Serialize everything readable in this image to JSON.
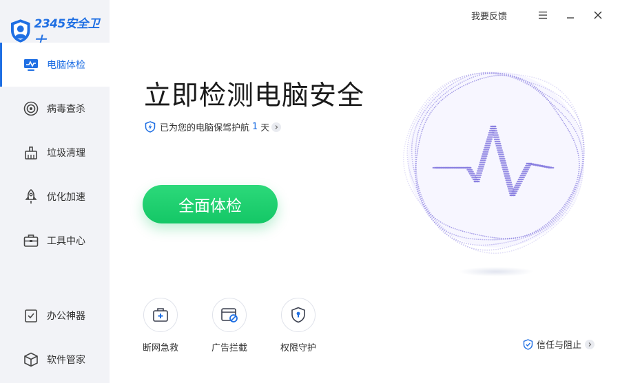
{
  "app": {
    "brand": "2345安全卫士"
  },
  "titlebar": {
    "feedback": "我要反馈",
    "menu_icon": "hamburger-menu-icon",
    "minimize_icon": "minimize-icon",
    "close_icon": "close-icon"
  },
  "sidebar": {
    "items": [
      {
        "label": "电脑体检",
        "icon": "monitor-check-icon",
        "active": true
      },
      {
        "label": "病毒查杀",
        "icon": "target-icon",
        "active": false
      },
      {
        "label": "垃圾清理",
        "icon": "broom-icon",
        "active": false
      },
      {
        "label": "优化加速",
        "icon": "rocket-icon",
        "active": false
      },
      {
        "label": "工具中心",
        "icon": "toolbox-icon",
        "active": false
      },
      {
        "label": "办公神器",
        "icon": "clipboard-check-icon",
        "active": false
      },
      {
        "label": "软件管家",
        "icon": "cube-icon",
        "active": false
      }
    ]
  },
  "main": {
    "headline": "立即检测电脑安全",
    "protect_prefix": "已为您的电脑保驾护航",
    "protect_days": "1",
    "protect_suffix": "天",
    "scan_button": "全面体检",
    "tools": [
      {
        "label": "断网急救",
        "icon": "first-aid-kit-icon"
      },
      {
        "label": "广告拦截",
        "icon": "ad-block-window-icon"
      },
      {
        "label": "权限守护",
        "icon": "shield-lock-icon"
      }
    ],
    "trust_label": "信任与阻止"
  },
  "colors": {
    "accent": "#1f6fe3",
    "scan_green": "#14c766",
    "sidebar_bg": "#f2f3f7",
    "orb_purple": "#8a7fe0"
  }
}
